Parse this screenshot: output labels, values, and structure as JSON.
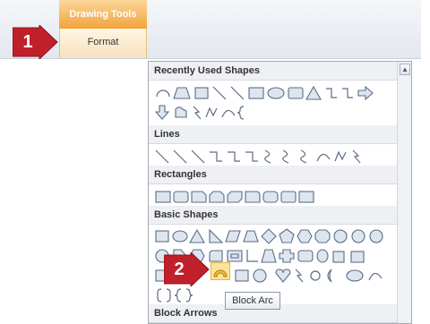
{
  "ribbon": {
    "context_tab_group": "Drawing Tools",
    "context_tab": "Format"
  },
  "steps": {
    "one": "1",
    "two": "2"
  },
  "gallery": {
    "sections": [
      {
        "heading": "Recently Used Shapes"
      },
      {
        "heading": "Lines"
      },
      {
        "heading": "Rectangles"
      },
      {
        "heading": "Basic Shapes"
      },
      {
        "heading": "Block Arrows"
      }
    ],
    "selected_shape": "block-arc",
    "scroll_up_glyph": "▲"
  },
  "tooltip": {
    "text": "Block Arc"
  },
  "colors": {
    "context_header": "#f3a23c",
    "step_badge": "#c0202a",
    "shape_stroke": "#5c6d84",
    "highlight": "#fde49a"
  }
}
